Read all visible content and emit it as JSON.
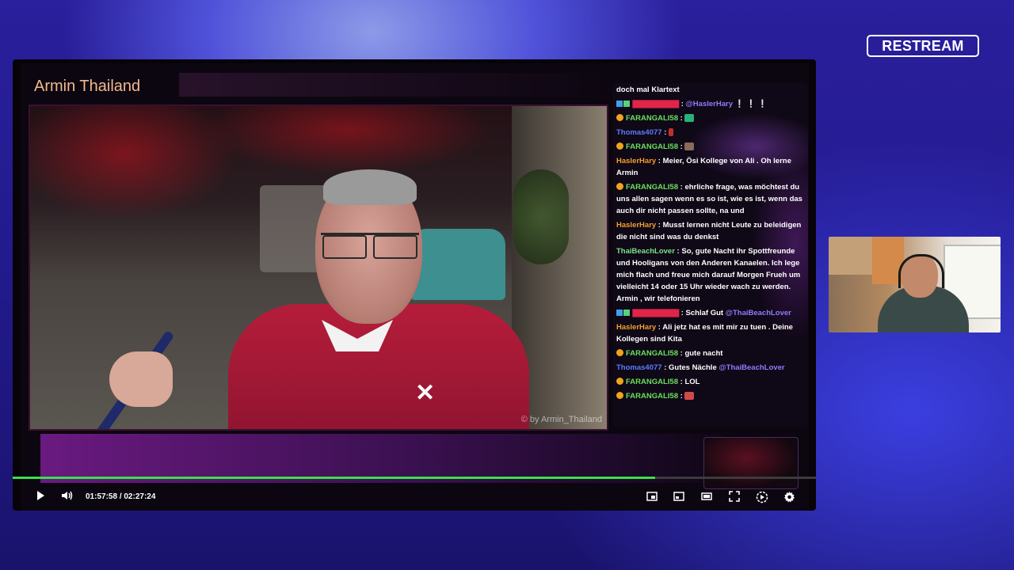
{
  "brand": {
    "logo_text": "RESTREAM"
  },
  "player": {
    "stream_title": "Armin Thailand",
    "watermark": "© by Armin_Thailand",
    "progress_fraction": 0.8,
    "current_time": "01:57:58",
    "separator": "/",
    "total_time": "02:27:24",
    "accent_color": "#39e04a"
  },
  "chat": {
    "messages": [
      {
        "user": "",
        "text": "doch mal Klartext"
      },
      {
        "user": "",
        "mention": "@HaslerHary",
        "text": ""
      },
      {
        "user": "FARANGALI58",
        "text": ""
      },
      {
        "user": "Thomas4077",
        "text": ""
      },
      {
        "user": "FARANGALI58",
        "text": ""
      },
      {
        "user": "HaslerHary",
        "text": "Meier, Ösi Kollege von Ali . Oh lerne Armin"
      },
      {
        "user": "FARANGALI58",
        "text": "ehrliche frage, was möchtest du uns allen sagen wenn es so ist, wie es ist, wenn das auch dir nicht passen sollte, na und"
      },
      {
        "user": "HaslerHary",
        "text": "Musst lernen nicht Leute zu beleidigen die nicht sind was du denkst"
      },
      {
        "user": "ThaiBeachLover",
        "text": "So, gute Nacht ihr Spottfreunde und Hooligans von den Anderen Kanaelen. Ich lege mich flach und freue mich darauf Morgen Frueh um vielleicht 14 oder 15 Uhr wieder wach zu werden. Armin , wir telefonieren"
      },
      {
        "user": "",
        "text": "Schlaf Gut",
        "mention": "@ThaiBeachLover"
      },
      {
        "user": "HaslerHary",
        "text": "Ali jetz hat es mit mir zu tuen . Deine Kollegen sind Kita"
      },
      {
        "user": "FARANGALI58",
        "text": "gute nacht"
      },
      {
        "user": "Thomas4077",
        "text": "Gutes Nächle",
        "mention": "@ThaiBeachLover"
      },
      {
        "user": "FARANGALI58",
        "text": "LOL"
      },
      {
        "user": "FARANGALI58",
        "text": ""
      }
    ]
  },
  "controls": {
    "play_icon": "play-icon",
    "volume_icon": "volume-icon",
    "pip_icon": "picture-in-picture-icon",
    "cast_icon": "cast-icon",
    "theater_icon": "theater-mode-icon",
    "fullscreen_icon": "fullscreen-icon",
    "speed_icon": "playback-speed-icon",
    "settings_icon": "gear-icon"
  }
}
